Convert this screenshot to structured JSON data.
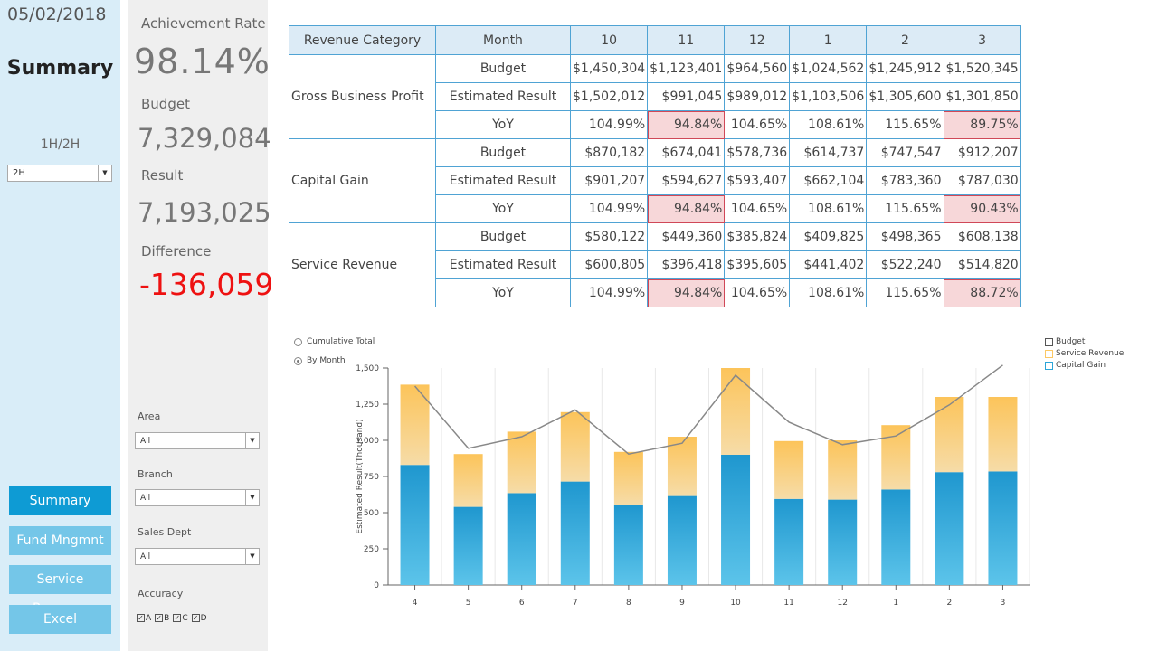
{
  "nav": {
    "date": "05/02/2018",
    "title": "Summary",
    "half_label": "1H/2H",
    "half_value": "2H",
    "buttons": [
      "Summary",
      "Fund Mngmnt",
      "Service Revenue",
      "Excel"
    ]
  },
  "metrics": {
    "achievement_label": "Achievement Rate",
    "achievement_value": "98.14%",
    "budget_label": "Budget",
    "budget_value": "7,329,084",
    "result_label": "Result",
    "result_value": "7,193,025",
    "difference_label": "Difference",
    "difference_value": "-136,059"
  },
  "filters": {
    "area_label": "Area",
    "area_value": "All",
    "branch_label": "Branch",
    "branch_value": "All",
    "dept_label": "Sales Dept",
    "dept_value": "All",
    "accuracy_label": "Accuracy",
    "accuracy_options": [
      "A",
      "B",
      "C",
      "D"
    ]
  },
  "table": {
    "headers": [
      "Revenue Category",
      "Month",
      "10",
      "11",
      "12",
      "1",
      "2",
      "3"
    ],
    "groups": [
      {
        "category": "Gross Business Profit",
        "rows": [
          {
            "label": "Budget",
            "values": [
              "$1,450,304",
              "$1,123,401",
              "$964,560",
              "$1,024,562",
              "$1,245,912",
              "$1,520,345"
            ]
          },
          {
            "label": "Estimated Result",
            "values": [
              "$1,502,012",
              "$991,045",
              "$989,012",
              "$1,103,506",
              "$1,305,600",
              "$1,301,850"
            ]
          },
          {
            "label": "YoY",
            "values": [
              "104.99%",
              "94.84%",
              "104.65%",
              "108.61%",
              "115.65%",
              "89.75%"
            ]
          }
        ]
      },
      {
        "category": "Capital Gain",
        "rows": [
          {
            "label": "Budget",
            "values": [
              "$870,182",
              "$674,041",
              "$578,736",
              "$614,737",
              "$747,547",
              "$912,207"
            ]
          },
          {
            "label": "Estimated Result",
            "values": [
              "$901,207",
              "$594,627",
              "$593,407",
              "$662,104",
              "$783,360",
              "$787,030"
            ]
          },
          {
            "label": "YoY",
            "values": [
              "104.99%",
              "94.84%",
              "104.65%",
              "108.61%",
              "115.65%",
              "90.43%"
            ]
          }
        ]
      },
      {
        "category": "Service Revenue",
        "rows": [
          {
            "label": "Budget",
            "values": [
              "$580,122",
              "$449,360",
              "$385,824",
              "$409,825",
              "$498,365",
              "$608,138"
            ]
          },
          {
            "label": "Estimated Result",
            "values": [
              "$600,805",
              "$396,418",
              "$395,605",
              "$441,402",
              "$522,240",
              "$514,820"
            ]
          },
          {
            "label": "YoY",
            "values": [
              "104.99%",
              "94.84%",
              "104.65%",
              "108.61%",
              "115.65%",
              "88.72%"
            ]
          }
        ]
      }
    ]
  },
  "chart_options": {
    "cumulative_label": "Cumulative Total",
    "by_month_label": "By Month",
    "selected": "By Month"
  },
  "chart_data": {
    "type": "bar",
    "stacked": true,
    "categories": [
      "4",
      "5",
      "6",
      "7",
      "8",
      "9",
      "10",
      "11",
      "12",
      "1",
      "2",
      "3"
    ],
    "ylabel": "Estimated Result(Thousand)",
    "ylim": [
      0,
      1500
    ],
    "yticks": [
      "0",
      "250",
      "500",
      "750",
      "1,000",
      "1,250",
      "1,500"
    ],
    "grid": true,
    "legend_position": "top-right",
    "series": [
      {
        "name": "Capital Gain",
        "kind": "bar",
        "color": "#2ba5d8",
        "values": [
          830,
          540,
          635,
          715,
          555,
          615,
          900,
          595,
          590,
          660,
          780,
          785
        ]
      },
      {
        "name": "Service Revenue",
        "kind": "bar",
        "color": "#fcc864",
        "values": [
          555,
          365,
          425,
          480,
          365,
          410,
          600,
          400,
          410,
          445,
          520,
          515
        ]
      },
      {
        "name": "Budget",
        "kind": "line",
        "color": "#888888",
        "values": [
          1375,
          945,
          1025,
          1210,
          905,
          980,
          1450,
          1125,
          970,
          1030,
          1245,
          1520
        ]
      }
    ]
  }
}
